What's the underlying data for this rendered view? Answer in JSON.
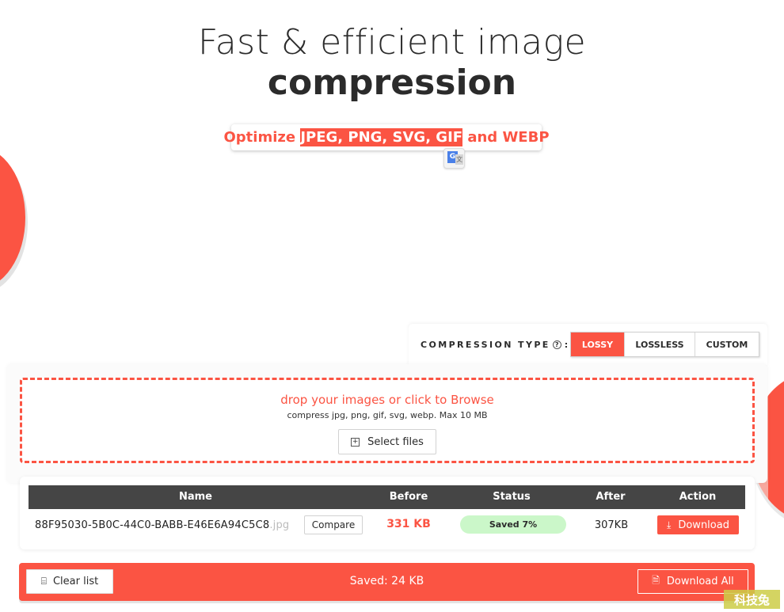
{
  "hero": {
    "title_line1": "Fast & efficient image",
    "title_line2": "compression"
  },
  "subtitle": {
    "prefix": "Optimize ",
    "highlighted": "JPEG, PNG, SVG, GIF",
    "suffix": " and WEBP"
  },
  "translate_popup": {
    "icon": "google-translate-icon",
    "g_glyph": "G",
    "t_glyph": "文"
  },
  "compression_type": {
    "label": "COMPRESSION TYPE",
    "help_glyph": "?",
    "colon": ":",
    "options": [
      {
        "label": "LOSSY",
        "active": true
      },
      {
        "label": "LOSSLESS",
        "active": false
      },
      {
        "label": "CUSTOM",
        "active": false
      }
    ]
  },
  "dropzone": {
    "title": "drop your images or click to Browse",
    "subtitle": "compress jpg, png, gif, svg, webp. Max 10 MB",
    "select_button": "Select files",
    "select_icon": "+"
  },
  "table": {
    "columns": [
      "Name",
      "Before",
      "Status",
      "After",
      "Action"
    ],
    "rows": [
      {
        "name": "88F95030-5B0C-44C0-BABB-E46E6A94C5C8",
        "name_faded": ".jpg",
        "compare_label": "Compare",
        "before": "331 KB",
        "status": "Saved 7%",
        "after": "307KB",
        "action_label": "Download",
        "action_icon": "⤓"
      }
    ]
  },
  "footer": {
    "clear_label": "Clear list",
    "clear_icon": "⌸",
    "saved_total": "Saved: 24 KB",
    "download_all_label": "Download All",
    "download_all_icon": "🗎"
  },
  "watermark": "科技兔",
  "colors": {
    "accent": "#fb5443",
    "header_dark": "#454545",
    "status_green": "#cbf7c9"
  }
}
